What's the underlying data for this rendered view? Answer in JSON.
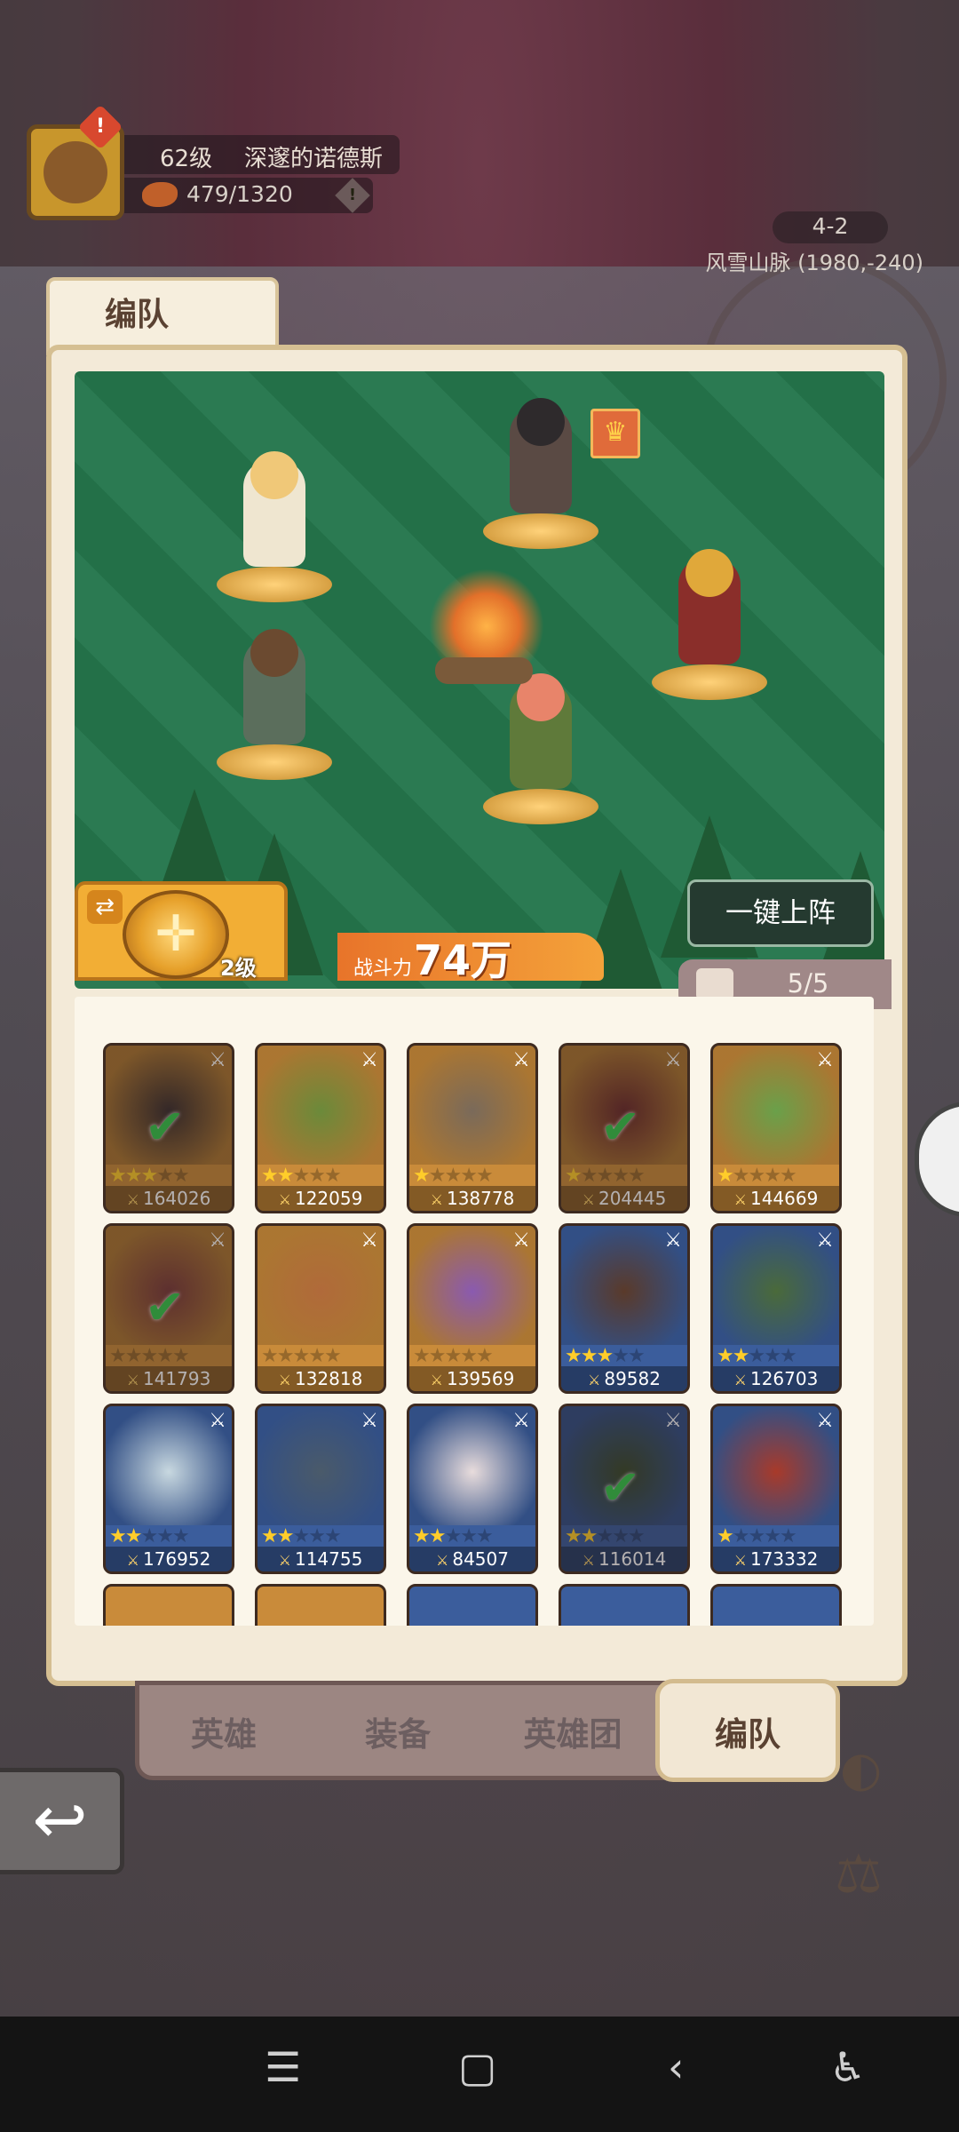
{
  "player": {
    "level": "62级",
    "name": "深邃的诺德斯",
    "food": "479/1320"
  },
  "location": {
    "stage": "4-2",
    "region": "风雪山脉 (1980,-240)"
  },
  "panel": {
    "title": "编队"
  },
  "formation": {
    "level": "2级",
    "power_label": "战斗力",
    "power_value": "74万",
    "deploy_label": "一键上阵",
    "count": "5/5"
  },
  "heroes": [
    {
      "stars": 3,
      "power": "164026",
      "frame": "orange",
      "in_team": true
    },
    {
      "stars": 2,
      "power": "122059",
      "frame": "orange",
      "in_team": false
    },
    {
      "stars": 1,
      "power": "138778",
      "frame": "orange",
      "in_team": false
    },
    {
      "stars": 1,
      "power": "204445",
      "frame": "orange",
      "in_team": true
    },
    {
      "stars": 1,
      "power": "144669",
      "frame": "orange",
      "in_team": false
    },
    {
      "stars": 0,
      "power": "141793",
      "frame": "orange",
      "in_team": true
    },
    {
      "stars": 0,
      "power": "132818",
      "frame": "orange",
      "in_team": false
    },
    {
      "stars": 0,
      "power": "139569",
      "frame": "orange",
      "in_team": false
    },
    {
      "stars": 3,
      "power": "89582",
      "frame": "blue",
      "in_team": false
    },
    {
      "stars": 2,
      "power": "126703",
      "frame": "blue",
      "in_team": false
    },
    {
      "stars": 2,
      "power": "176952",
      "frame": "blue",
      "in_team": false
    },
    {
      "stars": 2,
      "power": "114755",
      "frame": "blue",
      "in_team": false
    },
    {
      "stars": 2,
      "power": "84507",
      "frame": "blue",
      "in_team": false
    },
    {
      "stars": 2,
      "power": "116014",
      "frame": "blue",
      "in_team": true
    },
    {
      "stars": 1,
      "power": "173332",
      "frame": "blue",
      "in_team": false
    }
  ],
  "tabs": [
    "英雄",
    "装备",
    "英雄团",
    "编队"
  ],
  "colors": {
    "frame_orange": "#c98b3a",
    "frame_blue": "#3b5d9c",
    "check": "#35c84a",
    "star": "#ffcd2a"
  }
}
